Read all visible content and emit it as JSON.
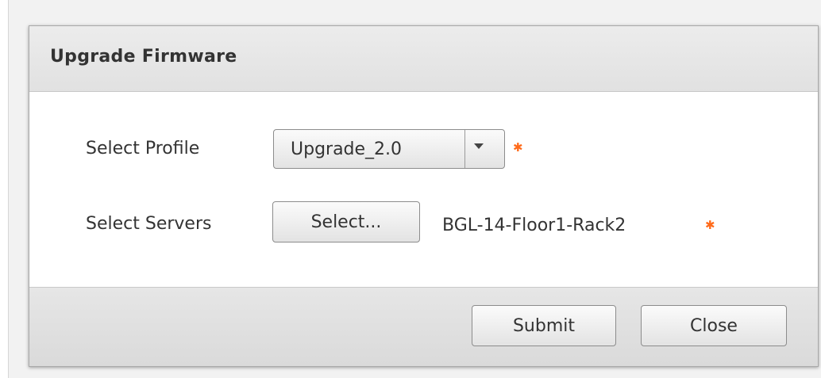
{
  "dialog": {
    "title": "Upgrade Firmware"
  },
  "form": {
    "profile_label": "Select Profile",
    "profile_selected": "Upgrade_2.0",
    "servers_label": "Select Servers",
    "select_button_label": "Select...",
    "servers_value": "BGL-14-Floor1-Rack2",
    "required_marker": "✱"
  },
  "footer": {
    "submit_label": "Submit",
    "close_label": "Close"
  },
  "colors": {
    "required": "#ff6a1a",
    "header_bg": "#e6e6e6",
    "footer_bg": "#dedede"
  },
  "icons": {
    "dropdown": "chevron-down-icon",
    "required": "asterisk-icon"
  }
}
